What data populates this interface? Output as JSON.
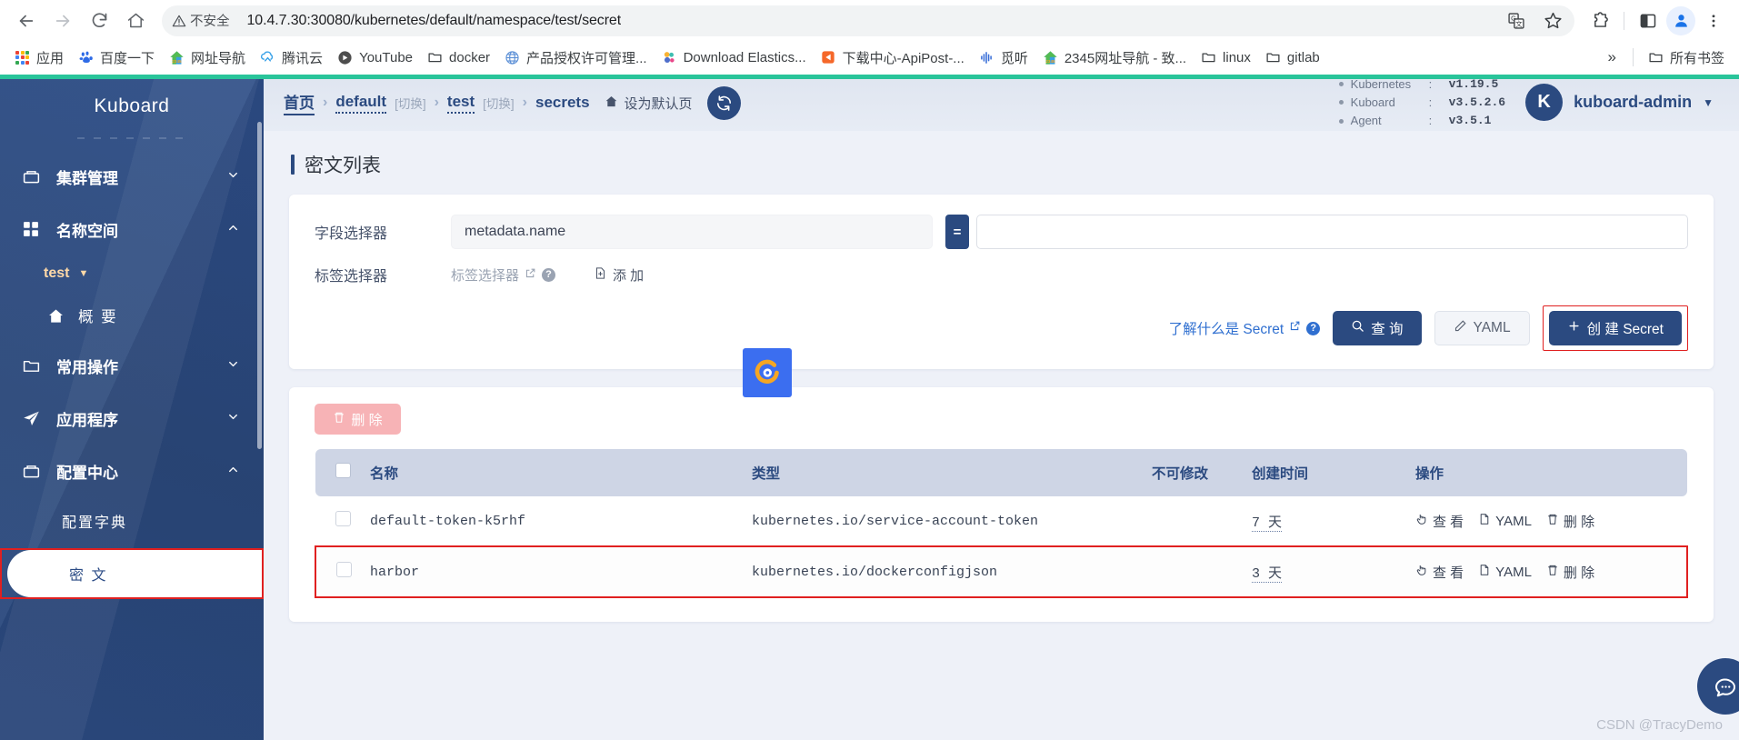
{
  "browser": {
    "back_icon": "back-arrow-icon",
    "forward_icon": "forward-arrow-icon",
    "reload_icon": "reload-icon",
    "home_icon": "home-icon",
    "security_label": "不安全",
    "url": "10.4.7.30:30080/kubernetes/default/namespace/test/secret",
    "translate_icon": "translate-icon",
    "bookmark_star_icon": "star-icon",
    "extensions_icon": "extensions-icon",
    "side_panel_icon": "side-panel-icon",
    "profile_icon": "profile-icon",
    "menu_icon": "three-dot-menu-icon"
  },
  "bookmarks": {
    "items": [
      {
        "label": "应用",
        "icon": "apps-grid-icon"
      },
      {
        "label": "百度一下",
        "icon": "baidu-icon"
      },
      {
        "label": "网址导航",
        "icon": "2345-navigation-icon"
      },
      {
        "label": "腾讯云",
        "icon": "tencent-cloud-icon"
      },
      {
        "label": "YouTube",
        "icon": "youtube-icon"
      },
      {
        "label": "docker",
        "icon": "folder-icon"
      },
      {
        "label": "产品授权许可管理...",
        "icon": "globe-icon"
      },
      {
        "label": "Download Elastics...",
        "icon": "elastic-icon"
      },
      {
        "label": "下载中心-ApiPost-...",
        "icon": "apipost-icon"
      },
      {
        "label": "觅听",
        "icon": "mitting-icon"
      },
      {
        "label": "2345网址导航 - 致...",
        "icon": "2345-navigation-icon"
      },
      {
        "label": "linux",
        "icon": "folder-icon"
      },
      {
        "label": "gitlab",
        "icon": "folder-icon"
      }
    ],
    "overflow_label": "»",
    "all_bookmarks_label": "所有书签",
    "all_bookmarks_icon": "folder-icon"
  },
  "sidebar": {
    "brand": "Kuboard",
    "groups": [
      {
        "label": "集群管理",
        "icon": "cluster-icon",
        "chevron": "⌄"
      },
      {
        "label": "名称空间",
        "icon": "namespace-grid-icon",
        "chevron": "⌃"
      }
    ],
    "namespace": {
      "label": "test",
      "caret": "▼"
    },
    "overview": {
      "label": "概 要",
      "icon": "home-icon"
    },
    "groups2": [
      {
        "label": "常用操作",
        "icon": "folder-icon",
        "chevron": "⌄"
      },
      {
        "label": "应用程序",
        "icon": "paper-plane-icon",
        "chevron": "⌄"
      },
      {
        "label": "配置中心",
        "icon": "config-box-icon",
        "chevron": "⌃"
      }
    ],
    "config_children": [
      {
        "label": "配置字典",
        "active": false
      },
      {
        "label": "密 文",
        "active": true
      }
    ]
  },
  "breadcrumb": {
    "home": "首页",
    "sep": "›",
    "namespace_cluster": "default",
    "switch1": "[切换]",
    "namespace": "test",
    "switch2": "[切换]",
    "resource": "secrets",
    "set_default": "设为默认页",
    "home_icon": "home-icon",
    "refresh_icon": "refresh-icon"
  },
  "versions": [
    {
      "name": "Kubernetes",
      "colon": ":",
      "value": "v1.19.5"
    },
    {
      "name": "Kuboard",
      "colon": ":",
      "value": "v3.5.2.6"
    },
    {
      "name": "Agent",
      "colon": ":",
      "value": "v3.5.1"
    }
  ],
  "user": {
    "initial": "K",
    "name": "kuboard-admin",
    "caret": "▼"
  },
  "page": {
    "title": "密文列表"
  },
  "filter": {
    "field_label": "字段选择器",
    "field_value": "metadata.name",
    "operator": "=",
    "value_placeholder": "",
    "value": "",
    "label_selector_label": "标签选择器",
    "label_selector_link": "标签选择器",
    "external_icon": "external-link-icon",
    "help_icon": "help-circle-icon",
    "add_label": "添 加",
    "add_icon": "add-box-icon"
  },
  "actions": {
    "learn_link": "了解什么是 Secret",
    "learn_external_icon": "external-link-icon",
    "learn_help_icon": "help-circle-icon",
    "search_label": "查 询",
    "search_icon": "search-icon",
    "yaml_label": "YAML",
    "yaml_icon": "edit-pencil-icon",
    "create_label": "创 建 Secret",
    "create_icon": "plus-icon"
  },
  "table": {
    "delete_button": "删 除",
    "delete_icon": "trash-icon",
    "headers": [
      "名称",
      "类型",
      "不可修改",
      "创建时间",
      "操作"
    ],
    "rows": [
      {
        "name": "default-token-k5rhf",
        "type": "kubernetes.io/service-account-token",
        "immutable": "",
        "age": "7 天",
        "ops": [
          {
            "label": "查 看",
            "icon": "cursor-click-icon"
          },
          {
            "label": "YAML",
            "icon": "document-icon"
          },
          {
            "label": "删 除",
            "icon": "trash-icon"
          }
        ],
        "highlight": false
      },
      {
        "name": "harbor",
        "type": "kubernetes.io/dockerconfigjson",
        "immutable": "",
        "age": "3 天",
        "ops": [
          {
            "label": "查 看",
            "icon": "cursor-click-icon"
          },
          {
            "label": "YAML",
            "icon": "document-icon"
          },
          {
            "label": "删 除",
            "icon": "trash-icon"
          }
        ],
        "highlight": true
      }
    ]
  },
  "overlays": {
    "browser_badge_icon": "360-browser-icon",
    "chat_fab_icon": "chat-bubble-icon",
    "watermark": "CSDN @TracyDemo"
  },
  "colors": {
    "accent_green": "#29c49a",
    "brand_blue": "#2b4a80",
    "link_blue": "#2f6fd0",
    "danger_red": "#e02020",
    "delete_pink": "#f7b3b6"
  }
}
